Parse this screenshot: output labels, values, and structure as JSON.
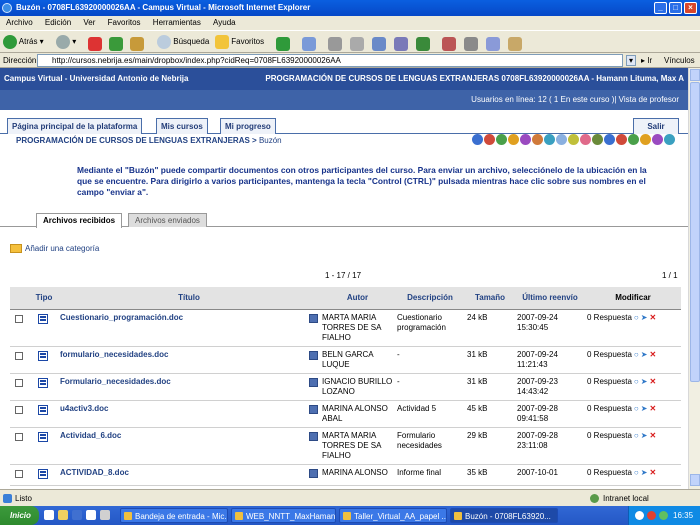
{
  "window": {
    "title": "Buzón - 0708FL63920000026AA - Campus Virtual - Microsoft Internet Explorer"
  },
  "menu": [
    "Archivo",
    "Edición",
    "Ver",
    "Favoritos",
    "Herramientas",
    "Ayuda"
  ],
  "toolbar": {
    "back_label": "Atrás",
    "search_label": "Búsqueda",
    "favorites_label": "Favoritos"
  },
  "address": {
    "label": "Dirección",
    "url": "http://cursos.nebrija.es/main/dropbox/index.php?cidReq=0708FL63920000026AA",
    "go_label": "Ir",
    "links_label": "Vínculos"
  },
  "site": {
    "campus": "Campus Virtual - Universidad Antonio de Nebrija",
    "course_header": "PROGRAMACIÓN DE CURSOS DE LENGUAS EXTRANJERAS 0708FL63920000026AA - Hamann Lituma, Max A",
    "online": "Usuarios en línea:  12  ( 1 En este curso )| Vista de profesor"
  },
  "nav": {
    "home": "Página principal de la plataforma",
    "courses": "Mis cursos",
    "progress": "Mi progreso",
    "logout": "Salir"
  },
  "breadcrumb": {
    "course": "PROGRAMACIÓN DE CURSOS DE LENGUAS EXTRANJERAS",
    "sep": " > ",
    "current": "Buzón"
  },
  "intro": "Mediante el \"Buzón\" puede compartir documentos con otros participantes del curso. Para enviar un archivo, selecciónelo de la ubicación en la que se encuentre. Para dirigirlo a varios participantes, mantenga la tecla \"Control (CTRL)\" pulsada mientras hace clic sobre sus nombres en el campo \"enviar a\".",
  "subtabs": {
    "received": "Archivos recibidos",
    "sent": "Archivos enviados"
  },
  "add_category": "Añadir una categoría",
  "pagination": {
    "range": "1 - 17 / 17",
    "pages": "1 / 1"
  },
  "table": {
    "headers": {
      "type": "Tipo",
      "title": "Título",
      "author": "Autor",
      "description": "Descripción",
      "size": "Tamaño",
      "last_sent": "Último reenvío",
      "modify": "Modificar"
    },
    "rows": [
      {
        "title": "Cuestionario_programación.doc",
        "author": "MARTA MARIA TORRES DE SA FIALHO",
        "description": "Cuestionario programación",
        "size": "24 kB",
        "date": "2007-09-24 15:30:45",
        "responses": "0 Respuesta"
      },
      {
        "title": "formulario_necesidades.doc",
        "author": "BELN GARCA LUQUE",
        "description": "-",
        "size": "31 kB",
        "date": "2007-09-24 11:21:43",
        "responses": "0 Respuesta"
      },
      {
        "title": "Formulario_necesidades.doc",
        "author": "IGNACIO BURILLO LOZANO",
        "description": "-",
        "size": "31 kB",
        "date": "2007-09-23 14:43:42",
        "responses": "0 Respuesta"
      },
      {
        "title": "u4activ3.doc",
        "author": "MARINA ALONSO ABAL",
        "description": "Actividad 5",
        "size": "45 kB",
        "date": "2007-09-28 09:41:58",
        "responses": "0 Respuesta"
      },
      {
        "title": "Actividad_6.doc",
        "author": "MARTA MARIA TORRES DE SA FIALHO",
        "description": "Formulario necesidades",
        "size": "29 kB",
        "date": "2007-09-28 23:11:08",
        "responses": "0 Respuesta"
      },
      {
        "title": "ACTIVIDAD_8.doc",
        "author": "MARINA ALONSO",
        "description": "Informe final",
        "size": "35 kB",
        "date": "2007-10-01",
        "responses": "0 Respuesta"
      }
    ]
  },
  "status": {
    "text": "Listo",
    "zone": "Intranet local"
  },
  "taskbar": {
    "start": "Inicio",
    "tasks": [
      "Bandeja de entrada - Mic...",
      "WEB_NNTT_MaxHamann",
      "Taller_Virtual_AA_papel ...",
      "Buzón - 0708FL63920..."
    ],
    "clock": "16:35"
  }
}
